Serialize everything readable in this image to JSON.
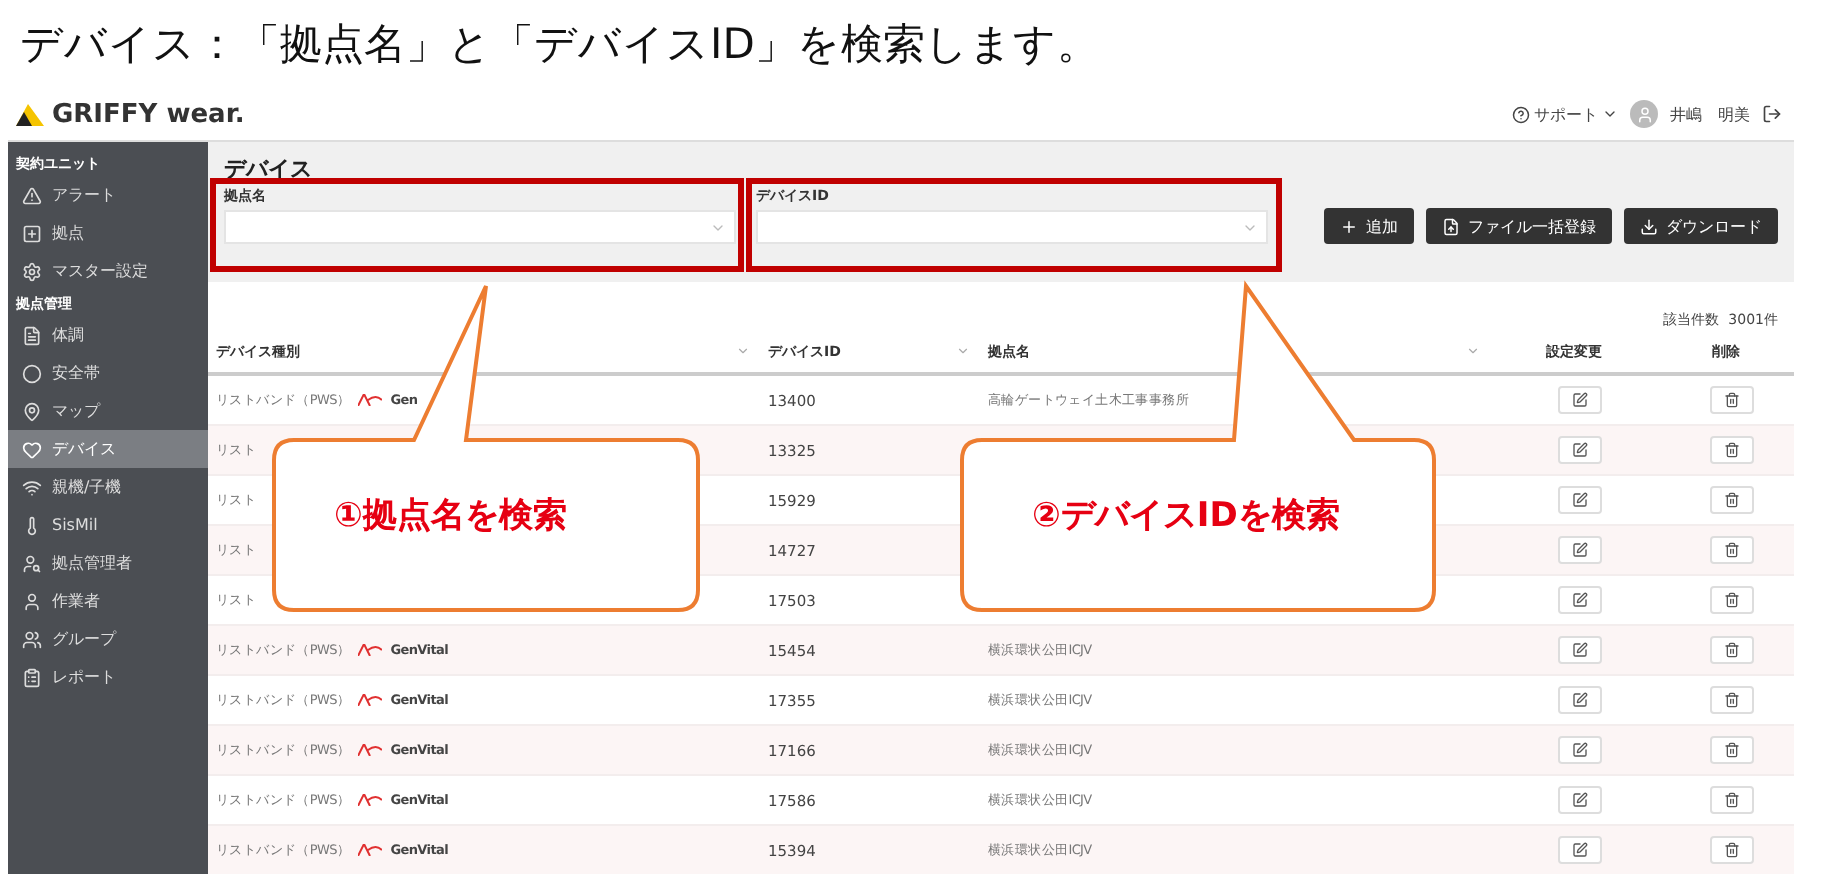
{
  "slide_title": "デバイス：「拠点名」と「デバイスID」を検索します。",
  "header": {
    "logo": "GRIFFY wear.",
    "support": "サポート",
    "user": "井嶋　明美"
  },
  "sidebar": {
    "sections": [
      {
        "heading": "契約ユニット",
        "items": [
          {
            "label": "アラート",
            "selected": false
          },
          {
            "label": "拠点",
            "selected": false
          },
          {
            "label": "マスター設定",
            "selected": false
          }
        ]
      },
      {
        "heading": "拠点管理",
        "items": [
          {
            "label": "体調",
            "selected": false
          },
          {
            "label": "安全帯",
            "selected": false
          },
          {
            "label": "マップ",
            "selected": false
          },
          {
            "label": "デバイス",
            "selected": true
          },
          {
            "label": "親機/子機",
            "selected": false
          },
          {
            "label": "SisMil",
            "selected": false
          },
          {
            "label": "拠点管理者",
            "selected": false
          },
          {
            "label": "作業者",
            "selected": false
          },
          {
            "label": "グループ",
            "selected": false
          },
          {
            "label": "レポート",
            "selected": false
          }
        ]
      }
    ]
  },
  "page": {
    "title": "デバイス",
    "filters": [
      {
        "label": "拠点名"
      },
      {
        "label": "デバイスID"
      }
    ],
    "buttons": [
      "追加",
      "ファイル一括登録",
      "ダウンロード"
    ],
    "count": "該当件数  3001件"
  },
  "table": {
    "columns": [
      "デバイス種別",
      "デバイスID",
      "拠点名",
      "設定変更",
      "削除"
    ],
    "rows": [
      {
        "device_type": "リストバンド（PWS）",
        "brand": "Gen",
        "device_id": "13400",
        "site": "高輪ゲートウェイ土木工事事務所"
      },
      {
        "device_type": "リスト",
        "device_id": "13325"
      },
      {
        "device_type": "リスト",
        "device_id": "15929"
      },
      {
        "device_type": "リスト",
        "device_id": "14727"
      },
      {
        "device_type": "リスト",
        "device_id": "17503"
      },
      {
        "device_type": "リストバンド（PWS）",
        "brand": "GenVital",
        "device_id": "15454",
        "site": "横浜環状公田ICJV"
      },
      {
        "device_type": "リストバンド（PWS）",
        "brand": "GenVital",
        "device_id": "17355",
        "site": "横浜環状公田ICJV"
      },
      {
        "device_type": "リストバンド（PWS）",
        "brand": "GenVital",
        "device_id": "17166",
        "site": "横浜環状公田ICJV"
      },
      {
        "device_type": "リストバンド（PWS）",
        "brand": "GenVital",
        "device_id": "17586",
        "site": "横浜環状公田ICJV"
      },
      {
        "device_type": "リストバンド（PWS）",
        "brand": "GenVital",
        "device_id": "15394",
        "site": "横浜環状公田ICJV"
      }
    ]
  },
  "callouts": [
    {
      "text": "①拠点名を検索"
    },
    {
      "text": "②デバイスIDを検索"
    }
  ]
}
